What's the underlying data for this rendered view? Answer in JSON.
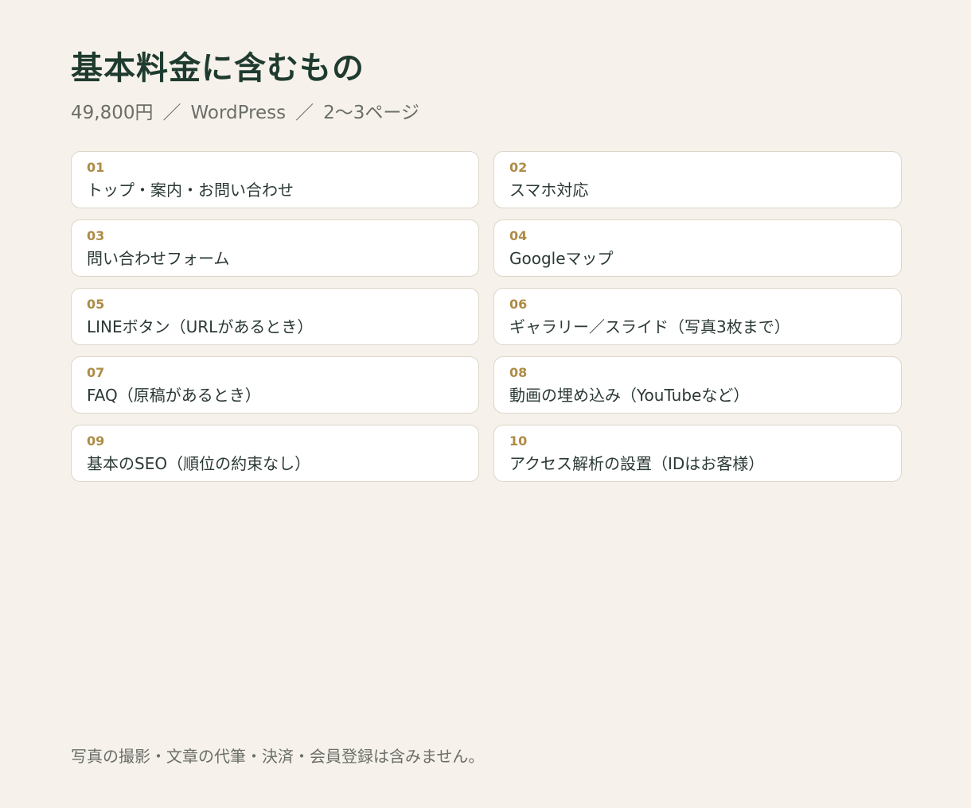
{
  "title": "基本料金に含むもの",
  "subtitle": {
    "price": "49,800円",
    "separator": "／",
    "platform": "WordPress",
    "pages": "2〜3ページ"
  },
  "items": [
    {
      "num": "01",
      "label": "トップ・案内・お問い合わせ"
    },
    {
      "num": "02",
      "label": "スマホ対応"
    },
    {
      "num": "03",
      "label": "問い合わせフォーム"
    },
    {
      "num": "04",
      "label": "Googleマップ"
    },
    {
      "num": "05",
      "label": "LINEボタン（URLがあるとき）"
    },
    {
      "num": "06",
      "label": "ギャラリー／スライド（写真3枚まで）"
    },
    {
      "num": "07",
      "label": "FAQ（原稿があるとき）"
    },
    {
      "num": "08",
      "label": "動画の埋め込み（YouTubeなど）"
    },
    {
      "num": "09",
      "label": "基本のSEO（順位の約束なし）"
    },
    {
      "num": "10",
      "label": "アクセス解析の設置（IDはお客様）"
    }
  ],
  "footnote": "写真の撮影・文章の代筆・決済・会員登録は含みません。",
  "colors": {
    "background": "#f6f2eb",
    "title": "#1f3b2f",
    "accent_number": "#ad8c45",
    "card_border": "#ddd6c8",
    "muted_text": "#6b6e68"
  }
}
